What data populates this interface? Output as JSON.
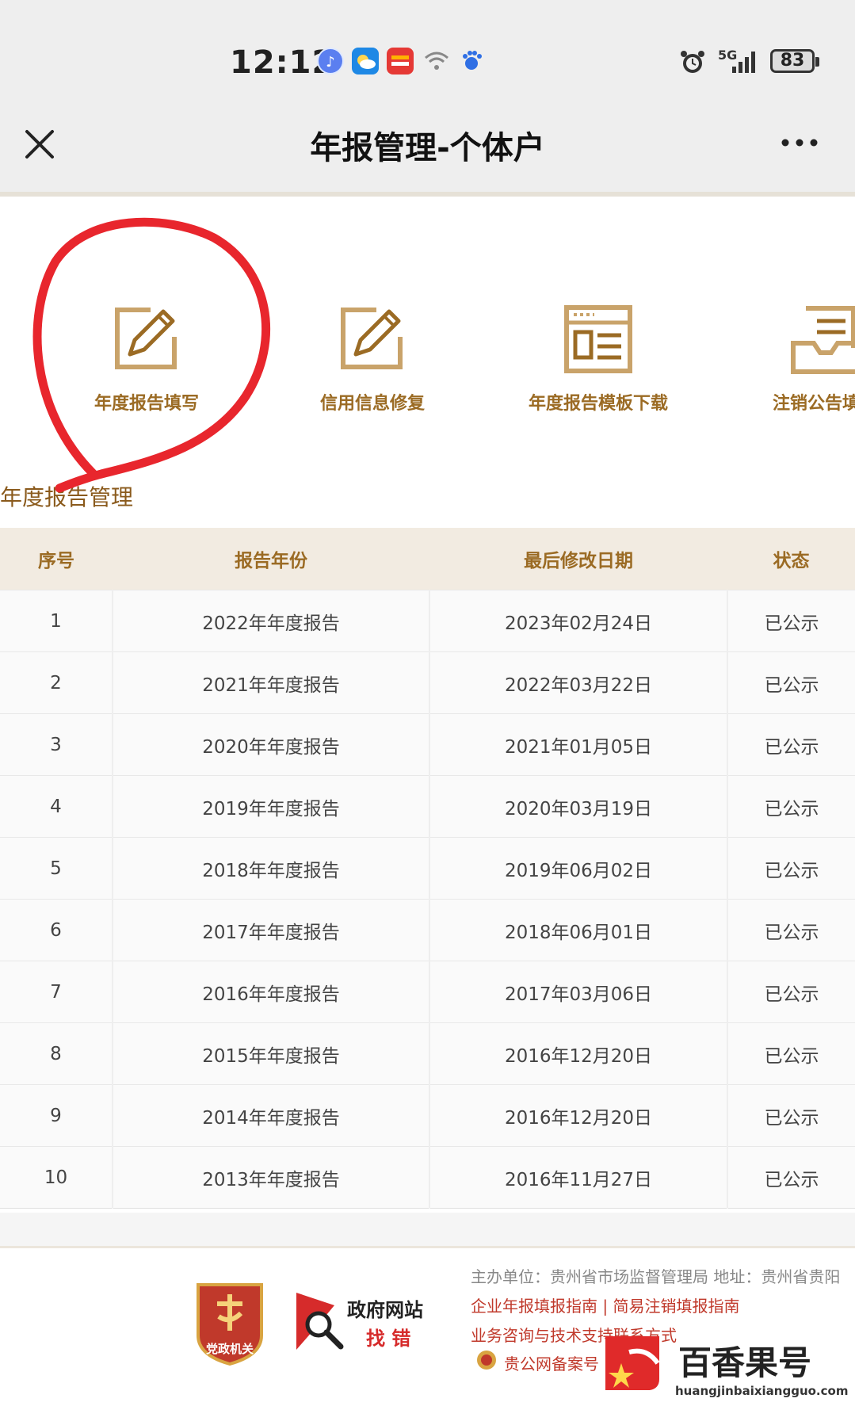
{
  "status_bar": {
    "time": "12:12",
    "network": "5G",
    "battery": "83"
  },
  "header": {
    "title": "年报管理-个体户"
  },
  "menu": [
    {
      "label": "年度报告填写",
      "icon": "edit-icon"
    },
    {
      "label": "信用信息修复",
      "icon": "edit-icon"
    },
    {
      "label": "年度报告模板下载",
      "icon": "template-icon"
    },
    {
      "label": "注销公告填",
      "icon": "notice-icon"
    }
  ],
  "section": {
    "title": "年度报告管理"
  },
  "table": {
    "headers": [
      "序号",
      "报告年份",
      "最后修改日期",
      "状态"
    ],
    "rows": [
      [
        "1",
        "2022年年度报告",
        "2023年02月24日",
        "已公示"
      ],
      [
        "2",
        "2021年年度报告",
        "2022年03月22日",
        "已公示"
      ],
      [
        "3",
        "2020年年度报告",
        "2021年01月05日",
        "已公示"
      ],
      [
        "4",
        "2019年年度报告",
        "2020年03月19日",
        "已公示"
      ],
      [
        "5",
        "2018年年度报告",
        "2019年06月02日",
        "已公示"
      ],
      [
        "6",
        "2017年年度报告",
        "2018年06月01日",
        "已公示"
      ],
      [
        "7",
        "2016年年度报告",
        "2017年03月06日",
        "已公示"
      ],
      [
        "8",
        "2015年年度报告",
        "2016年12月20日",
        "已公示"
      ],
      [
        "9",
        "2014年年度报告",
        "2016年12月20日",
        "已公示"
      ],
      [
        "10",
        "2013年年度报告",
        "2016年11月27日",
        "已公示"
      ]
    ]
  },
  "footer": {
    "badge_text": "党政机关",
    "gov_site_line1": "政府网站",
    "gov_site_line2": "找 错",
    "sponsor": "主办单位：贵州省市场监督管理局 地址：贵州省贵阳",
    "guides": "企业年报填报指南 | 简易注销填报指南",
    "support": "业务咨询与技术支持联系方式",
    "record": "贵公网备案号"
  },
  "watermark": {
    "name": "百香果号",
    "url": "huangjinbaixiangguo.com"
  },
  "colors": {
    "accent": "#9b6b24",
    "header_bg": "#f2ebe1",
    "footer_link": "#c0392b",
    "annotation_circle": "#e8262d"
  }
}
